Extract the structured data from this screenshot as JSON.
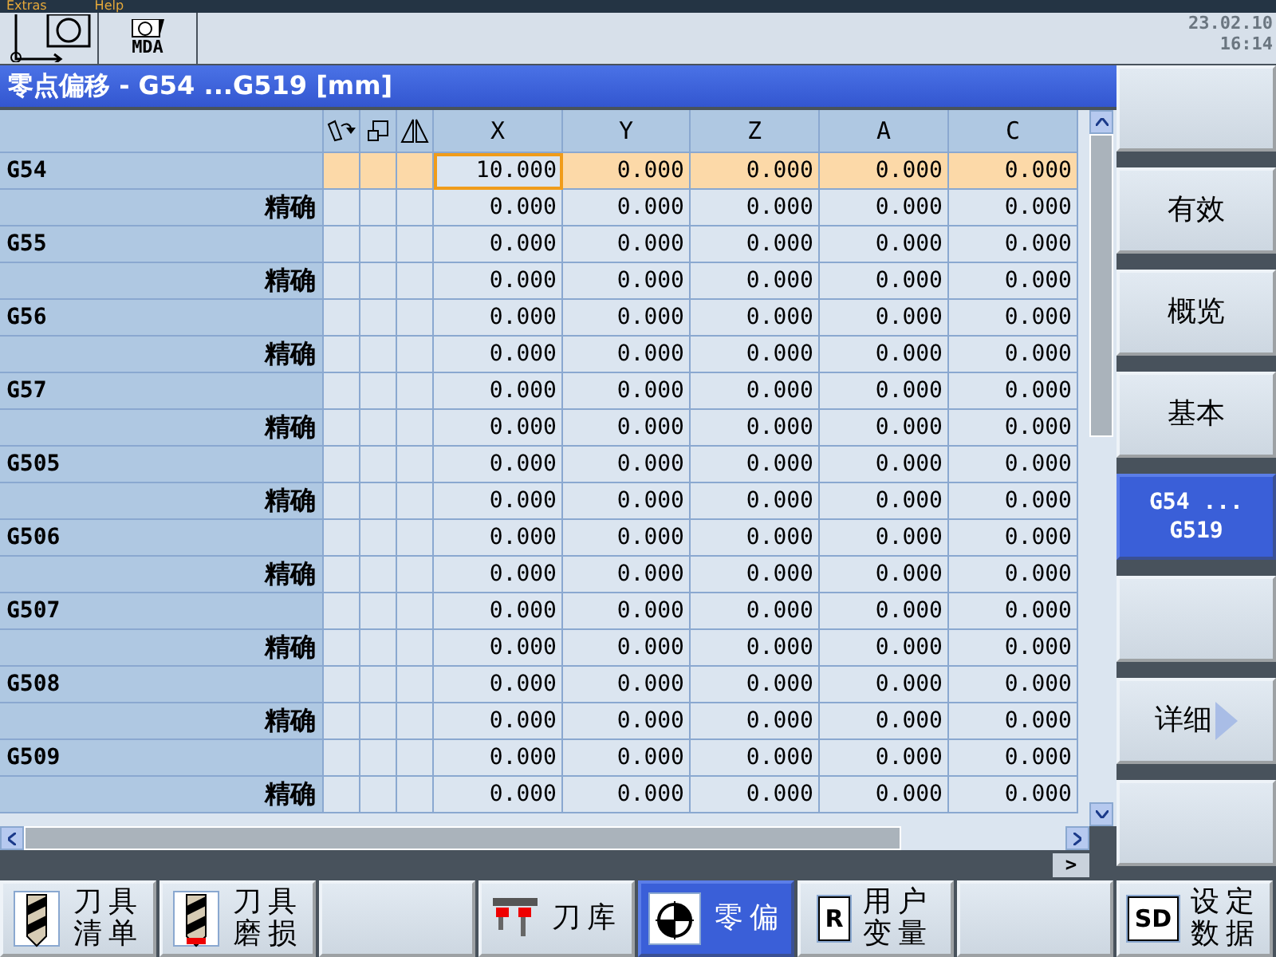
{
  "menu": [
    "Extras",
    "Help"
  ],
  "header": {
    "mode_buttons": [
      {
        "kind": "axes"
      },
      {
        "kind": "mda",
        "label": "MDA"
      }
    ],
    "date": "23.02.10",
    "time": "16:14"
  },
  "window": {
    "title": "零点偏移 - G54 ...G519 [mm]"
  },
  "table": {
    "columns": [
      "X",
      "Y",
      "Z",
      "A",
      "C"
    ],
    "rows": [
      {
        "label": "G54",
        "kind": "name",
        "selected": true,
        "cells": [
          {
            "value": "10.000",
            "focused": true
          },
          {
            "value": "0.000",
            "focused": false
          },
          {
            "value": "0.000",
            "focused": false
          },
          {
            "value": "0.000",
            "focused": false
          },
          {
            "value": "0.000",
            "focused": false
          }
        ]
      },
      {
        "label": "精确",
        "kind": "fine",
        "selected": false,
        "cells": [
          {
            "value": "0.000",
            "focused": false
          },
          {
            "value": "0.000",
            "focused": false
          },
          {
            "value": "0.000",
            "focused": false
          },
          {
            "value": "0.000",
            "focused": false
          },
          {
            "value": "0.000",
            "focused": false
          }
        ]
      },
      {
        "label": "G55",
        "kind": "name",
        "selected": false,
        "cells": [
          {
            "value": "0.000",
            "focused": false
          },
          {
            "value": "0.000",
            "focused": false
          },
          {
            "value": "0.000",
            "focused": false
          },
          {
            "value": "0.000",
            "focused": false
          },
          {
            "value": "0.000",
            "focused": false
          }
        ]
      },
      {
        "label": "精确",
        "kind": "fine",
        "selected": false,
        "cells": [
          {
            "value": "0.000",
            "focused": false
          },
          {
            "value": "0.000",
            "focused": false
          },
          {
            "value": "0.000",
            "focused": false
          },
          {
            "value": "0.000",
            "focused": false
          },
          {
            "value": "0.000",
            "focused": false
          }
        ]
      },
      {
        "label": "G56",
        "kind": "name",
        "selected": false,
        "cells": [
          {
            "value": "0.000",
            "focused": false
          },
          {
            "value": "0.000",
            "focused": false
          },
          {
            "value": "0.000",
            "focused": false
          },
          {
            "value": "0.000",
            "focused": false
          },
          {
            "value": "0.000",
            "focused": false
          }
        ]
      },
      {
        "label": "精确",
        "kind": "fine",
        "selected": false,
        "cells": [
          {
            "value": "0.000",
            "focused": false
          },
          {
            "value": "0.000",
            "focused": false
          },
          {
            "value": "0.000",
            "focused": false
          },
          {
            "value": "0.000",
            "focused": false
          },
          {
            "value": "0.000",
            "focused": false
          }
        ]
      },
      {
        "label": "G57",
        "kind": "name",
        "selected": false,
        "cells": [
          {
            "value": "0.000",
            "focused": false
          },
          {
            "value": "0.000",
            "focused": false
          },
          {
            "value": "0.000",
            "focused": false
          },
          {
            "value": "0.000",
            "focused": false
          },
          {
            "value": "0.000",
            "focused": false
          }
        ]
      },
      {
        "label": "精确",
        "kind": "fine",
        "selected": false,
        "cells": [
          {
            "value": "0.000",
            "focused": false
          },
          {
            "value": "0.000",
            "focused": false
          },
          {
            "value": "0.000",
            "focused": false
          },
          {
            "value": "0.000",
            "focused": false
          },
          {
            "value": "0.000",
            "focused": false
          }
        ]
      },
      {
        "label": "G505",
        "kind": "name",
        "selected": false,
        "cells": [
          {
            "value": "0.000",
            "focused": false
          },
          {
            "value": "0.000",
            "focused": false
          },
          {
            "value": "0.000",
            "focused": false
          },
          {
            "value": "0.000",
            "focused": false
          },
          {
            "value": "0.000",
            "focused": false
          }
        ]
      },
      {
        "label": "精确",
        "kind": "fine",
        "selected": false,
        "cells": [
          {
            "value": "0.000",
            "focused": false
          },
          {
            "value": "0.000",
            "focused": false
          },
          {
            "value": "0.000",
            "focused": false
          },
          {
            "value": "0.000",
            "focused": false
          },
          {
            "value": "0.000",
            "focused": false
          }
        ]
      },
      {
        "label": "G506",
        "kind": "name",
        "selected": false,
        "cells": [
          {
            "value": "0.000",
            "focused": false
          },
          {
            "value": "0.000",
            "focused": false
          },
          {
            "value": "0.000",
            "focused": false
          },
          {
            "value": "0.000",
            "focused": false
          },
          {
            "value": "0.000",
            "focused": false
          }
        ]
      },
      {
        "label": "精确",
        "kind": "fine",
        "selected": false,
        "cells": [
          {
            "value": "0.000",
            "focused": false
          },
          {
            "value": "0.000",
            "focused": false
          },
          {
            "value": "0.000",
            "focused": false
          },
          {
            "value": "0.000",
            "focused": false
          },
          {
            "value": "0.000",
            "focused": false
          }
        ]
      },
      {
        "label": "G507",
        "kind": "name",
        "selected": false,
        "cells": [
          {
            "value": "0.000",
            "focused": false
          },
          {
            "value": "0.000",
            "focused": false
          },
          {
            "value": "0.000",
            "focused": false
          },
          {
            "value": "0.000",
            "focused": false
          },
          {
            "value": "0.000",
            "focused": false
          }
        ]
      },
      {
        "label": "精确",
        "kind": "fine",
        "selected": false,
        "cells": [
          {
            "value": "0.000",
            "focused": false
          },
          {
            "value": "0.000",
            "focused": false
          },
          {
            "value": "0.000",
            "focused": false
          },
          {
            "value": "0.000",
            "focused": false
          },
          {
            "value": "0.000",
            "focused": false
          }
        ]
      },
      {
        "label": "G508",
        "kind": "name",
        "selected": false,
        "cells": [
          {
            "value": "0.000",
            "focused": false
          },
          {
            "value": "0.000",
            "focused": false
          },
          {
            "value": "0.000",
            "focused": false
          },
          {
            "value": "0.000",
            "focused": false
          },
          {
            "value": "0.000",
            "focused": false
          }
        ]
      },
      {
        "label": "精确",
        "kind": "fine",
        "selected": false,
        "cells": [
          {
            "value": "0.000",
            "focused": false
          },
          {
            "value": "0.000",
            "focused": false
          },
          {
            "value": "0.000",
            "focused": false
          },
          {
            "value": "0.000",
            "focused": false
          },
          {
            "value": "0.000",
            "focused": false
          }
        ]
      },
      {
        "label": "G509",
        "kind": "name",
        "selected": false,
        "cells": [
          {
            "value": "0.000",
            "focused": false
          },
          {
            "value": "0.000",
            "focused": false
          },
          {
            "value": "0.000",
            "focused": false
          },
          {
            "value": "0.000",
            "focused": false
          },
          {
            "value": "0.000",
            "focused": false
          }
        ]
      },
      {
        "label": "精确",
        "kind": "fine",
        "selected": false,
        "cells": [
          {
            "value": "0.000",
            "focused": false
          },
          {
            "value": "0.000",
            "focused": false
          },
          {
            "value": "0.000",
            "focused": false
          },
          {
            "value": "0.000",
            "focused": false
          },
          {
            "value": "0.000",
            "focused": false
          }
        ]
      }
    ]
  },
  "more_button": ">",
  "side_softkeys": [
    {
      "selected": false
    },
    {
      "lines": [
        "有效"
      ],
      "selected": false
    },
    {
      "lines": [
        "概览"
      ],
      "selected": false
    },
    {
      "lines": [
        "基本"
      ],
      "selected": false
    },
    {
      "lines": [
        "G54 ...",
        "G519"
      ],
      "selected": true
    },
    {
      "selected": false
    },
    {
      "lines": [
        "详细"
      ],
      "selected": false,
      "arrow": true
    },
    {
      "selected": false
    }
  ],
  "bottom_softkeys": [
    {
      "kind": "drill",
      "lines": [
        "刀具",
        "清单"
      ],
      "selected": false
    },
    {
      "kind": "drill-worn",
      "lines": [
        "刀具",
        "磨损"
      ],
      "selected": false
    },
    {
      "selected": false
    },
    {
      "kind": "magazine",
      "lines": [
        "刀库"
      ],
      "selected": false
    },
    {
      "kind": "target",
      "lines": [
        "零偏"
      ],
      "selected": true
    },
    {
      "kind": "letter",
      "icon_text": "R",
      "lines": [
        "用户",
        "变量"
      ],
      "selected": false
    },
    {
      "selected": false
    },
    {
      "kind": "letter",
      "icon_text": "SD",
      "lines": [
        "设定",
        "数据"
      ],
      "selected": false
    }
  ]
}
